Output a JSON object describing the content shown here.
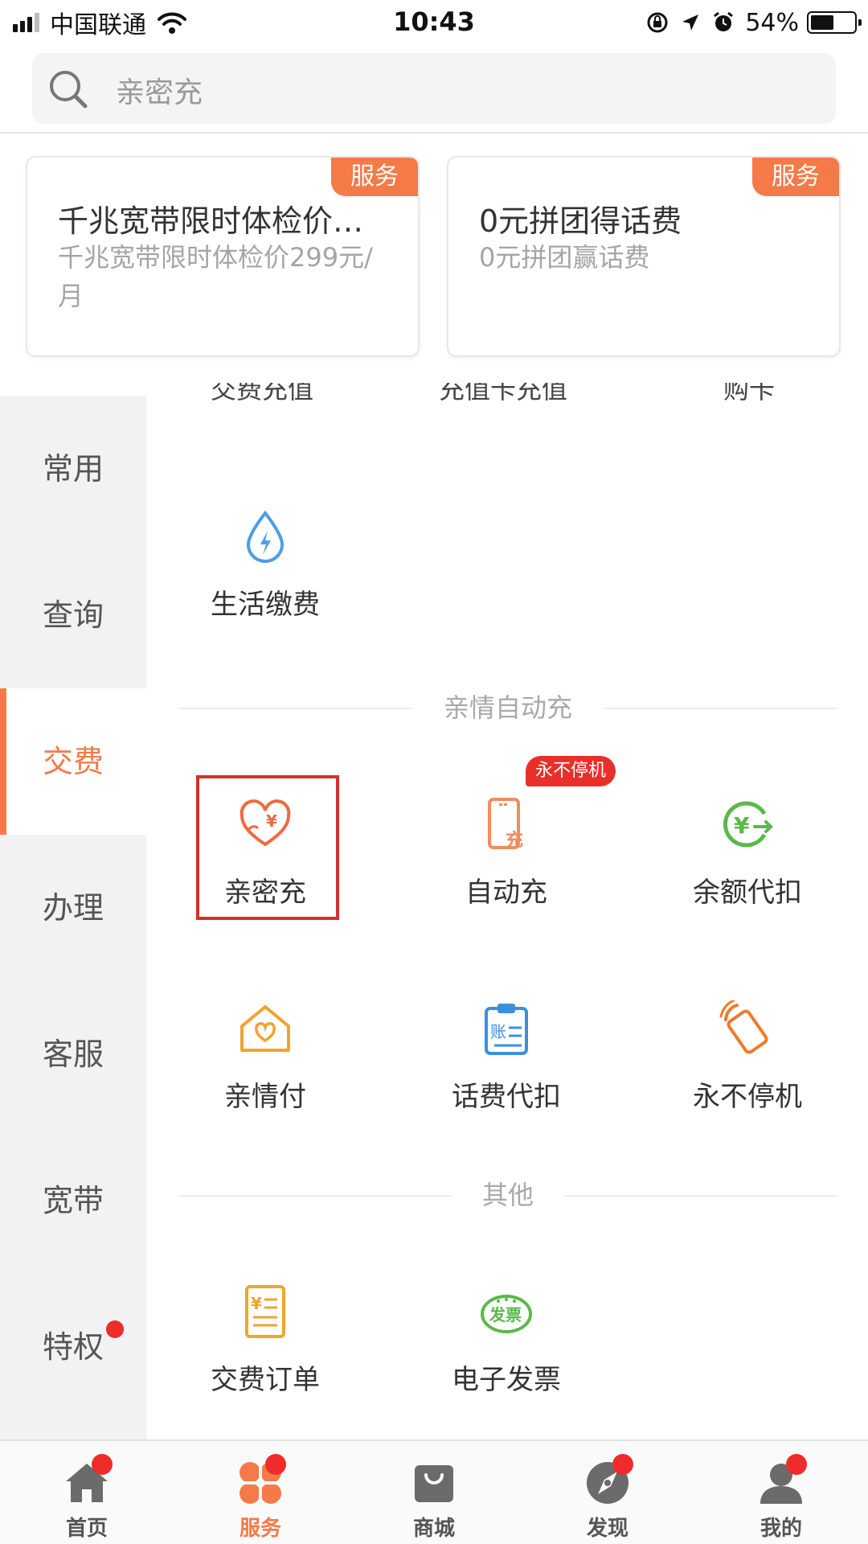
{
  "status_bar": {
    "carrier": "中国联通",
    "time": "10:43",
    "battery": "54%",
    "battery_level": 0.54
  },
  "search": {
    "placeholder": "亲密充"
  },
  "cards": [
    {
      "tag": "服务",
      "title": "千兆宽带限时体检价…",
      "desc": "千兆宽带限时体检价299元/月"
    },
    {
      "tag": "服务",
      "title": "0元拼团得话费",
      "desc": "0元拼团赢话费"
    }
  ],
  "sidebar": {
    "items": [
      {
        "label": "常用"
      },
      {
        "label": "查询"
      },
      {
        "label": "交费"
      },
      {
        "label": "办理"
      },
      {
        "label": "客服"
      },
      {
        "label": "宽带"
      },
      {
        "label": "特权"
      }
    ],
    "active": "交费"
  },
  "cut_row": [
    "交费充值",
    "充值卡充值",
    "购卡"
  ],
  "life": {
    "label": "生活缴费",
    "icon": "water-drop-bolt-icon"
  },
  "sections": {
    "family": {
      "title": "亲情自动充",
      "badge": "永不停机",
      "items": [
        {
          "label": "亲密充",
          "icon": "heart-yen-icon",
          "color": "#ef6a3e"
        },
        {
          "label": "自动充",
          "icon": "phone-recharge-icon",
          "color": "#f28b60"
        },
        {
          "label": "余额代扣",
          "icon": "yen-arrow-icon",
          "color": "#5bb84a"
        },
        {
          "label": "亲情付",
          "icon": "home-heart-icon",
          "color": "#f0a42f"
        },
        {
          "label": "话费代扣",
          "icon": "clipboard-bill-icon",
          "color": "#3b8fe0"
        },
        {
          "label": "永不停机",
          "icon": "phone-signal-icon",
          "color": "#f07a2a"
        }
      ]
    },
    "other": {
      "title": "其他",
      "items": [
        {
          "label": "交费订单",
          "icon": "order-receipt-icon",
          "color": "#f0a42f"
        },
        {
          "label": "电子发票",
          "icon": "invoice-badge-icon",
          "color": "#5bb84a"
        }
      ]
    }
  },
  "bottom_nav": {
    "items": [
      {
        "label": "首页",
        "icon": "home-icon"
      },
      {
        "label": "服务",
        "icon": "service-grid-icon"
      },
      {
        "label": "商城",
        "icon": "shopping-bag-icon"
      },
      {
        "label": "发现",
        "icon": "compass-icon"
      },
      {
        "label": "我的",
        "icon": "user-icon"
      }
    ],
    "active": "服务"
  },
  "colors": {
    "accent": "#f47a48",
    "highlight": "#d32f2f",
    "badge": "#e8302a"
  }
}
